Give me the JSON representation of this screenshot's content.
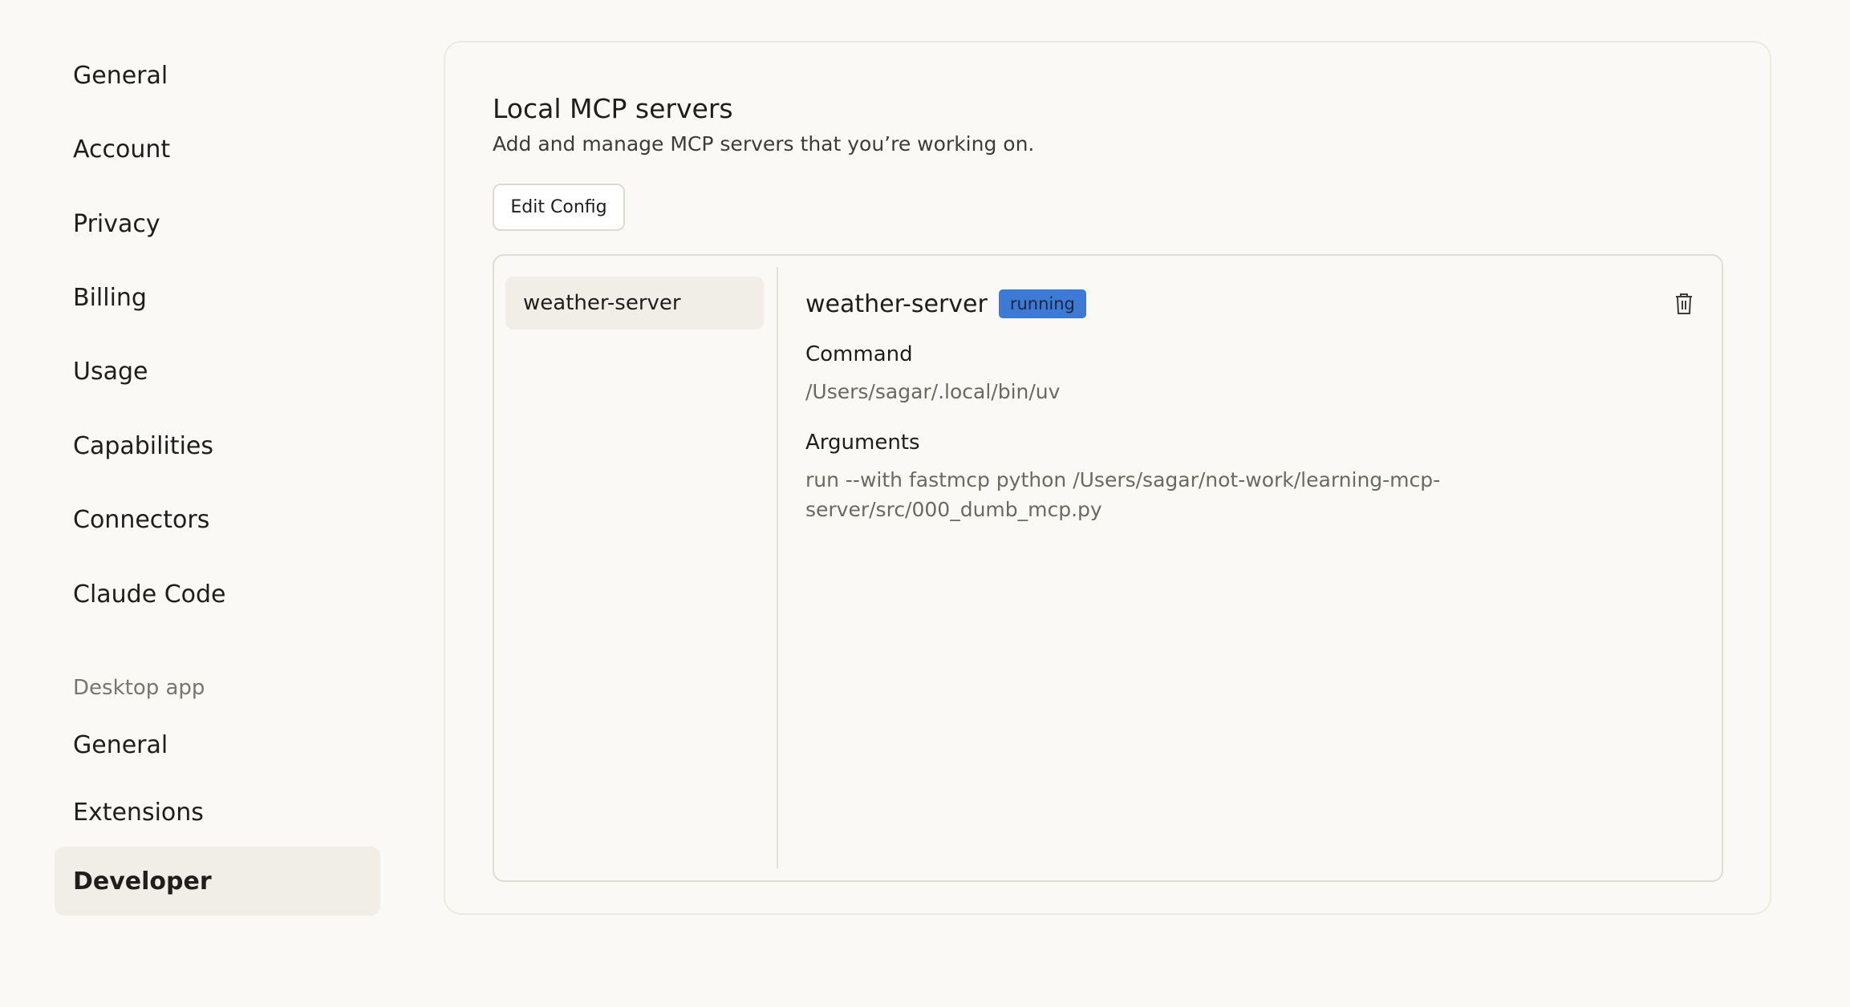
{
  "sidebar": {
    "items": [
      {
        "label": "General"
      },
      {
        "label": "Account"
      },
      {
        "label": "Privacy"
      },
      {
        "label": "Billing"
      },
      {
        "label": "Usage"
      },
      {
        "label": "Capabilities"
      },
      {
        "label": "Connectors"
      },
      {
        "label": "Claude Code"
      }
    ],
    "desktop_heading": "Desktop app",
    "desktop_items": [
      {
        "label": "General"
      },
      {
        "label": "Extensions"
      },
      {
        "label": "Developer",
        "active": true
      }
    ]
  },
  "main": {
    "title": "Local MCP servers",
    "subtitle": "Add and manage MCP servers that you’re working on.",
    "edit_config_label": "Edit Config",
    "servers": [
      {
        "name": "weather-server",
        "selected": true
      }
    ],
    "detail": {
      "name": "weather-server",
      "status": "running",
      "status_color": "#3d7ad6",
      "command_label": "Command",
      "command_value": "/Users/sagar/.local/bin/uv",
      "arguments_label": "Arguments",
      "arguments_value": "run --with fastmcp python /Users/sagar/not-work/learning-mcp-server/src/000_dumb_mcp.py",
      "delete_icon": "trash-icon"
    }
  }
}
